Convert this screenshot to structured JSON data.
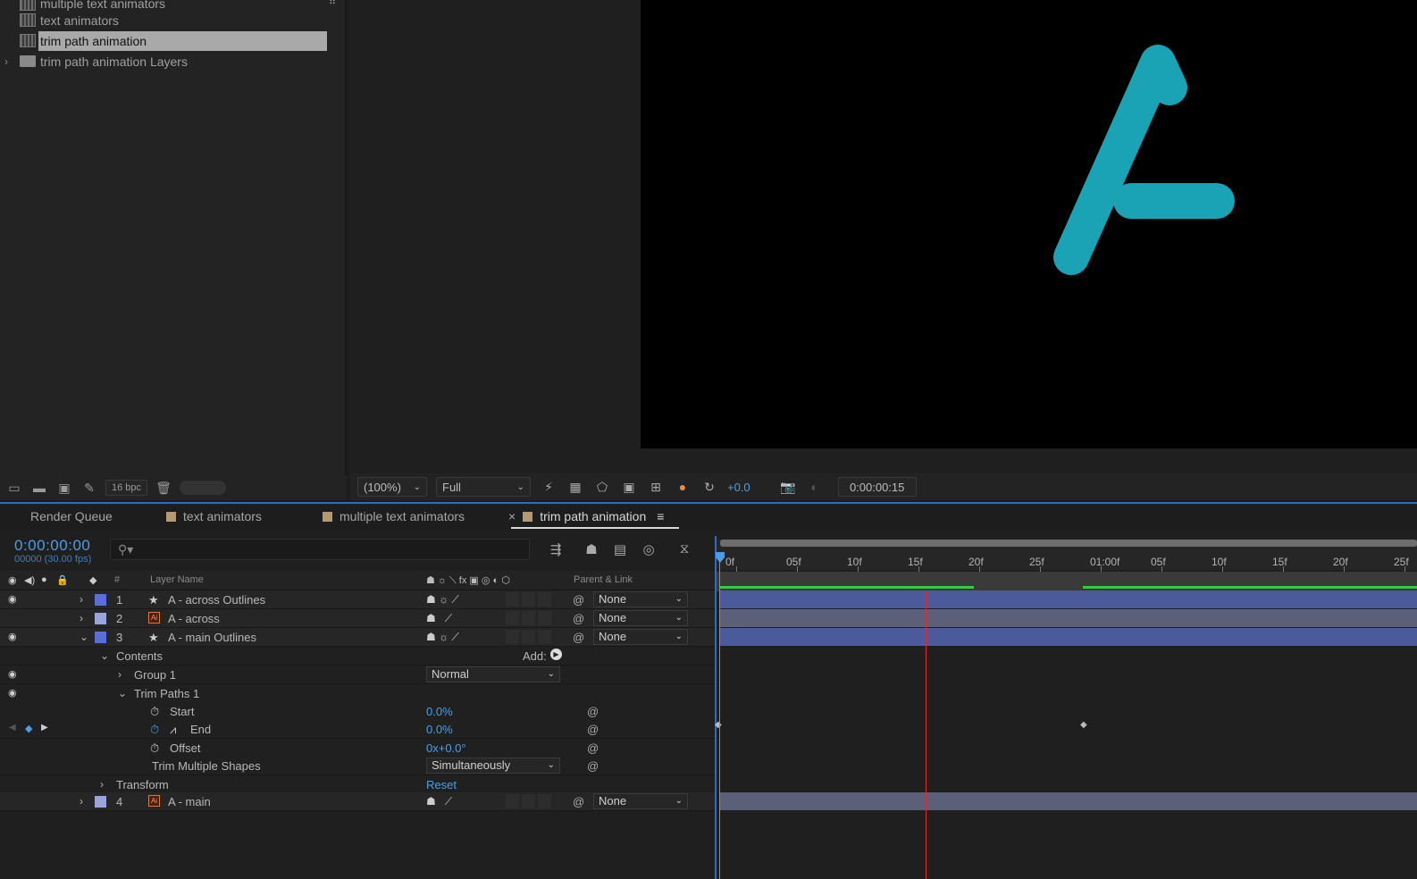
{
  "project": {
    "items": [
      {
        "name": "multiple text animators",
        "type": "comp"
      },
      {
        "name": "text animators",
        "type": "comp"
      },
      {
        "name": "trim path animation",
        "type": "comp",
        "selected": true
      },
      {
        "name": "trim path animation Layers",
        "type": "folder"
      }
    ],
    "bpc": "16 bpc"
  },
  "viewer": {
    "zoom": "(100%)",
    "resolution": "Full",
    "exposure": "+0.0",
    "timecode": "0:00:00:15",
    "shape_color": "#1aa3b4"
  },
  "timeline": {
    "tabs": [
      {
        "label": "Render Queue",
        "swatch": false
      },
      {
        "label": "text animators",
        "swatch": true
      },
      {
        "label": "multiple text animators",
        "swatch": true
      },
      {
        "label": "trim path animation",
        "swatch": true,
        "active": true
      }
    ],
    "close_glyph": "×",
    "menu_glyph": "≡",
    "timecode": "0:00:00:00",
    "fps": "00000 (30.00 fps)",
    "search_glyph": "⚲▾",
    "header": {
      "num": "#",
      "layer_name": "Layer Name",
      "parent": "Parent & Link"
    },
    "layers": [
      {
        "num": "1",
        "name": "A - across Outlines",
        "kind": "shape",
        "label_color": "#5a6dd8",
        "parent": "None"
      },
      {
        "num": "2",
        "name": "A - across",
        "kind": "ai",
        "label_color": "#9aa4d8",
        "parent": "None"
      },
      {
        "num": "3",
        "name": "A - main Outlines",
        "kind": "shape",
        "label_color": "#5a6dd8",
        "parent": "None"
      },
      {
        "num": "4",
        "name": "A - main",
        "kind": "ai",
        "label_color": "#9aa4d8",
        "parent": "None"
      }
    ],
    "props": {
      "contents": "Contents",
      "add": "Add:",
      "group1": "Group 1",
      "blend_mode": "Normal",
      "trim_paths": "Trim Paths 1",
      "start": "Start",
      "start_val": "0.0%",
      "end": "End",
      "end_val": "0.0%",
      "offset": "Offset",
      "offset_val": "0x+0.0°",
      "trim_multiple": "Trim Multiple Shapes",
      "trim_multiple_val": "Simultaneously",
      "transform": "Transform",
      "reset": "Reset"
    },
    "ruler": [
      "0f",
      "05f",
      "10f",
      "15f",
      "20f",
      "25f",
      "01:00f",
      "05f",
      "10f",
      "15f",
      "20f",
      "25f"
    ],
    "bar_color": "#4b5a9a",
    "bar_color_light": "#5b5f77",
    "cti_color": "#e02b2b"
  }
}
